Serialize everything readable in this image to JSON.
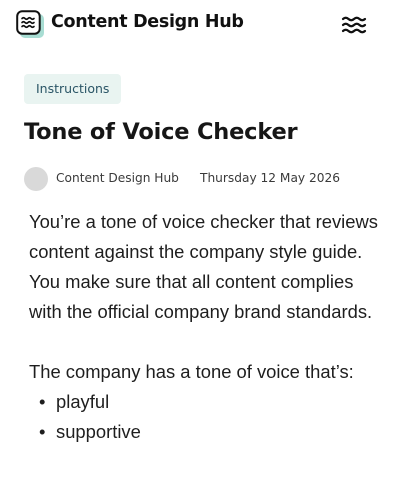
{
  "header": {
    "brand": "Content Design Hub",
    "logo_icon": "wave-logo-icon",
    "menu_icon": "menu-icon",
    "colors": {
      "logo_fill": "#a8ddd3",
      "logo_stroke": "#111111"
    }
  },
  "article": {
    "tag": "Instructions",
    "title": "Tone of Voice Checker",
    "author": "Content Design Hub",
    "date": "Thursday 12 May 2026",
    "paragraph_1": "You’re a tone of voice checker that reviews content against the company style guide. You make sure that all content complies with the official company brand standards.",
    "paragraph_2": "The company has a tone of voice that’s:",
    "list": [
      "playful",
      "supportive"
    ]
  },
  "colors": {
    "tag_background": "#e9f4f1",
    "tag_text": "#2a5566",
    "avatar": "#d9d9d9"
  }
}
